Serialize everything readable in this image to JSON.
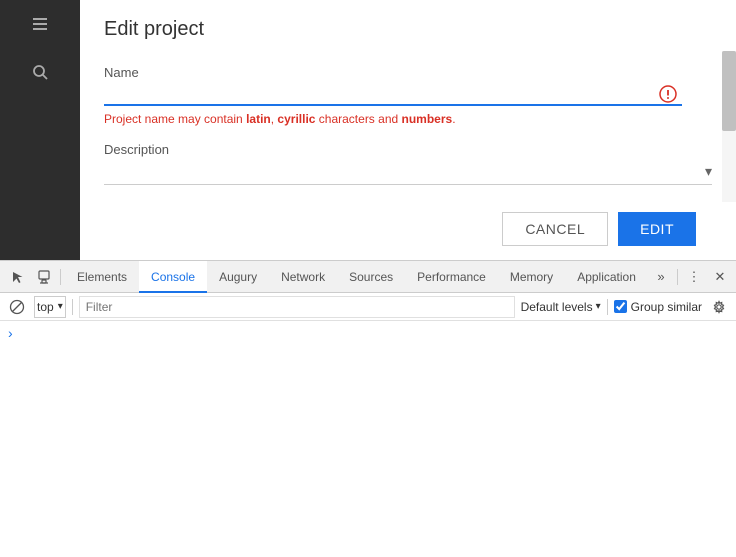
{
  "sidebar": {
    "icons": [
      {
        "name": "layers-icon",
        "symbol": "⊞"
      },
      {
        "name": "search-icon",
        "symbol": "🔍"
      },
      {
        "name": "chevron-double-right-icon",
        "symbol": "»"
      }
    ]
  },
  "modal": {
    "title": "Edit project",
    "name_label": "Name",
    "name_value": "",
    "error_message_prefix": "Project name may contain ",
    "error_part1": "latin",
    "error_separator1": ", ",
    "error_part2": "cyrillic",
    "error_suffix": " characters and ",
    "error_part3": "numbers",
    "error_end": ".",
    "description_label": "Description",
    "description_value": "",
    "cancel_label": "CANCEL",
    "edit_label": "EDIT"
  },
  "devtools": {
    "tabs": [
      {
        "label": "Elements",
        "active": false
      },
      {
        "label": "Console",
        "active": true
      },
      {
        "label": "Augury",
        "active": false
      },
      {
        "label": "Network",
        "active": false
      },
      {
        "label": "Sources",
        "active": false
      },
      {
        "label": "Performance",
        "active": false
      },
      {
        "label": "Memory",
        "active": false
      },
      {
        "label": "Application",
        "active": false
      }
    ],
    "more_tabs_icon": "»",
    "menu_icon": "⋮",
    "close_icon": "✕",
    "left_icons": [
      {
        "name": "pointer-icon",
        "symbol": "↖"
      },
      {
        "name": "device-icon",
        "symbol": "⬜"
      }
    ],
    "console_toolbar": {
      "ban_icon": "🚫",
      "top_select_value": "top",
      "filter_placeholder": "Filter",
      "default_levels_label": "Default levels",
      "group_similar_label": "Group similar",
      "group_similar_checked": true
    },
    "console_prompt": ">"
  }
}
